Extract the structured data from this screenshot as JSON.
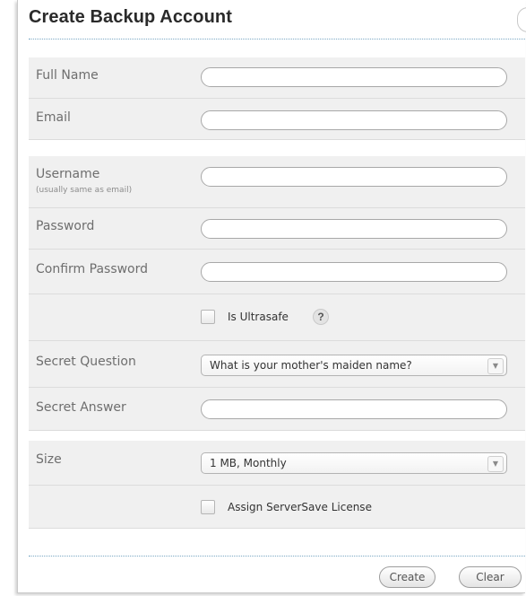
{
  "dialog": {
    "title": "Create Backup Account"
  },
  "fields": {
    "full_name": {
      "label": "Full Name",
      "value": ""
    },
    "email": {
      "label": "Email",
      "value": ""
    },
    "username": {
      "label": "Username",
      "sublabel": "(usually same as email)",
      "value": ""
    },
    "password": {
      "label": "Password",
      "value": ""
    },
    "confirm_password": {
      "label": "Confirm Password",
      "value": ""
    },
    "ultrasafe": {
      "label": "Is Ultrasafe",
      "checked": false,
      "help": "?"
    },
    "secret_question": {
      "label": "Secret Question",
      "selected": "What is your mother's maiden name?"
    },
    "secret_answer": {
      "label": "Secret Answer",
      "value": ""
    },
    "size": {
      "label": "Size",
      "selected": "1 MB, Monthly"
    },
    "serversave": {
      "label": "Assign ServerSave License",
      "checked": false
    }
  },
  "buttons": {
    "create": "Create",
    "clear": "Clear"
  }
}
